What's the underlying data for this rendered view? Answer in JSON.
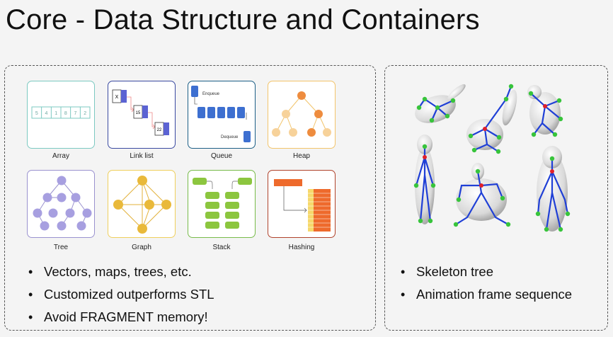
{
  "slide": {
    "title": "Core - Data Structure and Containers"
  },
  "left": {
    "cards": [
      {
        "label": "Array",
        "color": "#7cc9c1"
      },
      {
        "label": "Link list",
        "color": "#3a4aa0"
      },
      {
        "label": "Queue",
        "color": "#1d5f86"
      },
      {
        "label": "Heap",
        "color": "#f2c46b"
      },
      {
        "label": "Tree",
        "color": "#9a92cf"
      },
      {
        "label": "Graph",
        "color": "#efcf5d"
      },
      {
        "label": "Stack",
        "color": "#78bb4a"
      },
      {
        "label": "Hashing",
        "color": "#b0432c"
      }
    ],
    "array_values": [
      "5",
      "4",
      "1",
      "8",
      "7",
      "2"
    ],
    "linklist_values": [
      "X",
      "15",
      "22"
    ],
    "queue_labels": {
      "enqueue": "Enqueue",
      "dequeue": "Dequeue"
    },
    "bullets": [
      "Vectors, maps, trees, etc.",
      "Customized outperforms STL",
      "Avoid FRAGMENT memory!"
    ]
  },
  "right": {
    "bullets": [
      "Skeleton tree",
      "Animation frame sequence"
    ]
  }
}
